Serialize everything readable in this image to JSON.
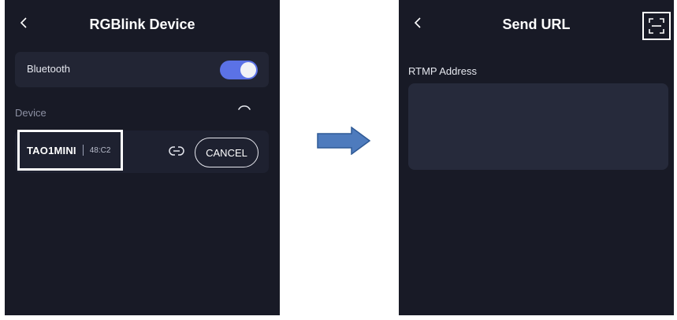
{
  "left_screen": {
    "title": "RGBlink Device",
    "bluetooth_label": "Bluetooth",
    "bluetooth_on": true,
    "device_section_label": "Device",
    "device": {
      "name": "TAO1MINI",
      "mac": "48:C2",
      "cancel_label": "CANCEL"
    }
  },
  "right_screen": {
    "title": "Send URL",
    "rtmp_label": "RTMP Address",
    "rtmp_value": "",
    "rtmp_placeholder": ""
  },
  "icons": {
    "back": "chevron-left-icon",
    "loading": "spinner-icon",
    "link": "link-icon",
    "scan": "scan-qr-icon",
    "arrow": "right-arrow-icon"
  },
  "colors": {
    "screen_bg": "#181a26",
    "card_bg": "#222534",
    "toggle_on": "#5b72e6",
    "arrow_fill": "#4e7bbd",
    "arrow_stroke": "#2f5a96"
  }
}
